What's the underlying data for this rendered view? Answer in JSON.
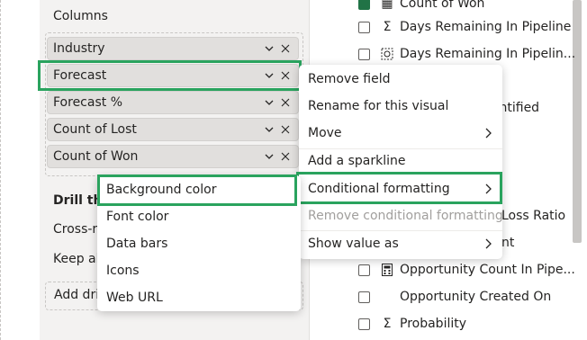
{
  "build_pane": {
    "columns_title": "Columns",
    "fields": [
      {
        "label": "Industry"
      },
      {
        "label": "Forecast"
      },
      {
        "label": "Forecast %"
      },
      {
        "label": "Count of Lost"
      },
      {
        "label": "Count of Won"
      }
    ],
    "drillthrough_title": "Drill thr",
    "cross_report_label": "Cross-r",
    "keep_all_label": "Keep al",
    "add_drillthrough_label": "Add dri"
  },
  "data_pane": {
    "items": [
      {
        "label": "Count of Won",
        "checked": true,
        "icon": "calculator-icon"
      },
      {
        "label": "Days Remaining In Pipeline",
        "checked": false,
        "icon": "sigma-icon"
      },
      {
        "label": "Days Remaining In Pipelin...",
        "checked": false,
        "icon": "measure-icon"
      },
      {
        "label": "dentified",
        "checked": false,
        "icon": ""
      },
      {
        "label": "Loss Ratio",
        "checked": false,
        "icon": ""
      },
      {
        "label": "nt",
        "checked": false,
        "icon": ""
      },
      {
        "label": "Opportunity Count In Pipe...",
        "checked": false,
        "icon": "calculator-icon"
      },
      {
        "label": "Opportunity Created On",
        "checked": false,
        "icon": ""
      },
      {
        "label": "Probability",
        "checked": false,
        "icon": "sigma-icon"
      }
    ]
  },
  "context_menu": {
    "items": [
      {
        "label": "Remove field"
      },
      {
        "label": "Rename for this visual"
      },
      {
        "label": "Move"
      },
      {
        "label": "Add a sparkline"
      },
      {
        "label": "Conditional formatting"
      },
      {
        "label": "Remove conditional formatting"
      },
      {
        "label": "Show value as"
      }
    ]
  },
  "submenu": {
    "items": [
      {
        "label": "Background color"
      },
      {
        "label": "Font color"
      },
      {
        "label": "Data bars"
      },
      {
        "label": "Icons"
      },
      {
        "label": "Web URL"
      }
    ]
  },
  "colors": {
    "highlight": "#2aa35e",
    "checkbox_checked": "#217346",
    "disabled_text": "#a19f9d"
  }
}
